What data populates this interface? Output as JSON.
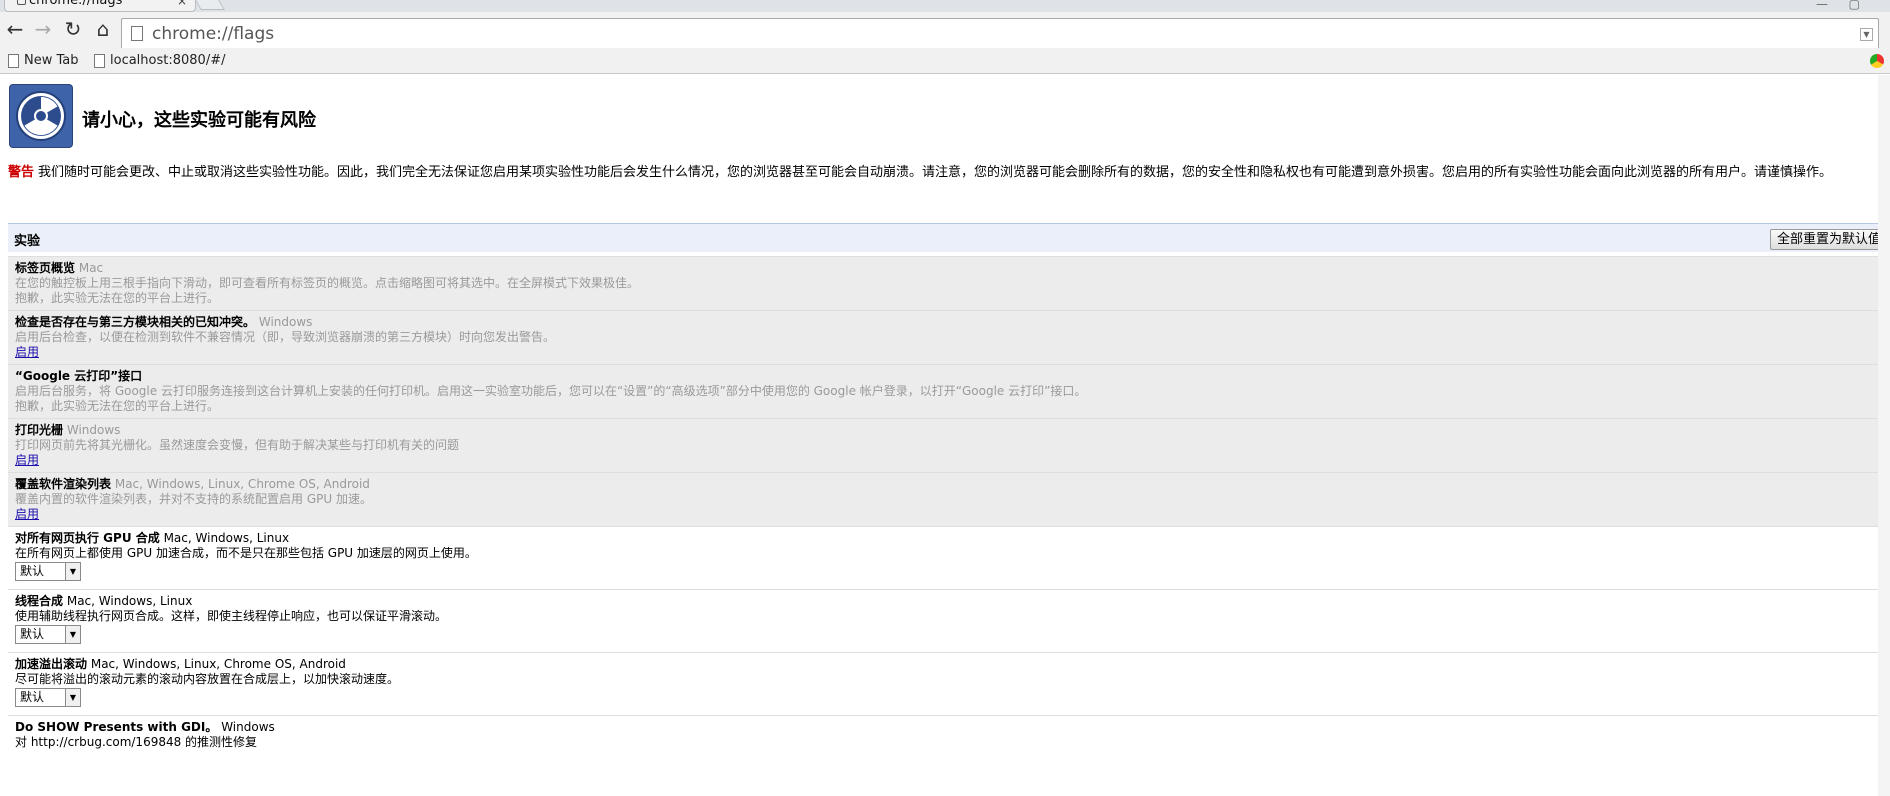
{
  "browser": {
    "tab_title": "chrome://flags",
    "tab_close": "×",
    "url": "chrome://flags",
    "win_minimize": "—",
    "win_restore": "▢",
    "bookmarks": [
      {
        "label": "New Tab"
      },
      {
        "label": "localhost:8080/#/"
      }
    ]
  },
  "page": {
    "title": "请小心，这些实验可能有风险",
    "warning_label": "警告",
    "warning_text": "我们随时可能会更改、中止或取消这些实验性功能。因此，我们完全无法保证您启用某项实验性功能后会发生什么情况，您的浏览器甚至可能会自动崩溃。请注意，您的浏览器可能会删除所有的数据，您的安全性和隐私权也有可能遭到意外损害。您启用的所有实验性功能会面向此浏览器的所有用户。请谨慎操作。",
    "experiments_title": "实验",
    "reset_button": "全部重置为默认值"
  },
  "experiments": [
    {
      "name": "标签页概览",
      "platforms": "Mac",
      "desc": "在您的触控板上用三根手指向下滑动，即可查看所有标签页的概览。点击缩略图可将其选中。在全屏模式下效果极佳。",
      "note": "抱歉，此实验无法在您的平台上进行。"
    },
    {
      "name": "检查是否存在与第三方模块相关的已知冲突。",
      "platforms": "Windows",
      "desc": "启用后台检查，以便在检测到软件不兼容情况（即，导致浏览器崩溃的第三方模块）时向您发出警告。",
      "link": "启用"
    },
    {
      "name": "“Google 云打印”接口",
      "platforms": "",
      "desc": "启用后台服务，将 Google 云打印服务连接到这台计算机上安装的任何打印机。启用这一实验室功能后，您可以在“设置”的“高级选项”部分中使用您的 Google 帐户登录，以打开“Google 云打印”接口。",
      "note": "抱歉，此实验无法在您的平台上进行。"
    },
    {
      "name": "打印光栅",
      "platforms": "Windows",
      "desc": "打印网页前先将其光栅化。虽然速度会变慢，但有助于解决某些与打印机有关的问题",
      "link": "启用"
    },
    {
      "name": "覆盖软件渲染列表",
      "platforms": "Mac, Windows, Linux, Chrome OS, Android",
      "desc": "覆盖内置的软件渲染列表，并对不支持的系统配置启用 GPU 加速。",
      "link": "启用"
    },
    {
      "name": "对所有网页执行 GPU 合成",
      "platforms": "Mac, Windows, Linux",
      "desc": "在所有网页上都使用 GPU 加速合成，而不是只在那些包括 GPU 加速层的网页上使用。",
      "select": "默认"
    },
    {
      "name": "线程合成",
      "platforms": "Mac, Windows, Linux",
      "desc": "使用辅助线程执行网页合成。这样，即使主线程停止响应，也可以保证平滑滚动。",
      "select": "默认"
    },
    {
      "name": "加速溢出滚动",
      "platforms": "Mac, Windows, Linux, Chrome OS, Android",
      "desc": "尽可能将溢出的滚动元素的滚动内容放置在合成层上，以加快滚动速度。",
      "select": "默认"
    },
    {
      "name": "Do SHOW Presents with GDI。",
      "platforms": "Windows",
      "desc": "对 http://crbug.com/169848 的推测性修复"
    }
  ]
}
